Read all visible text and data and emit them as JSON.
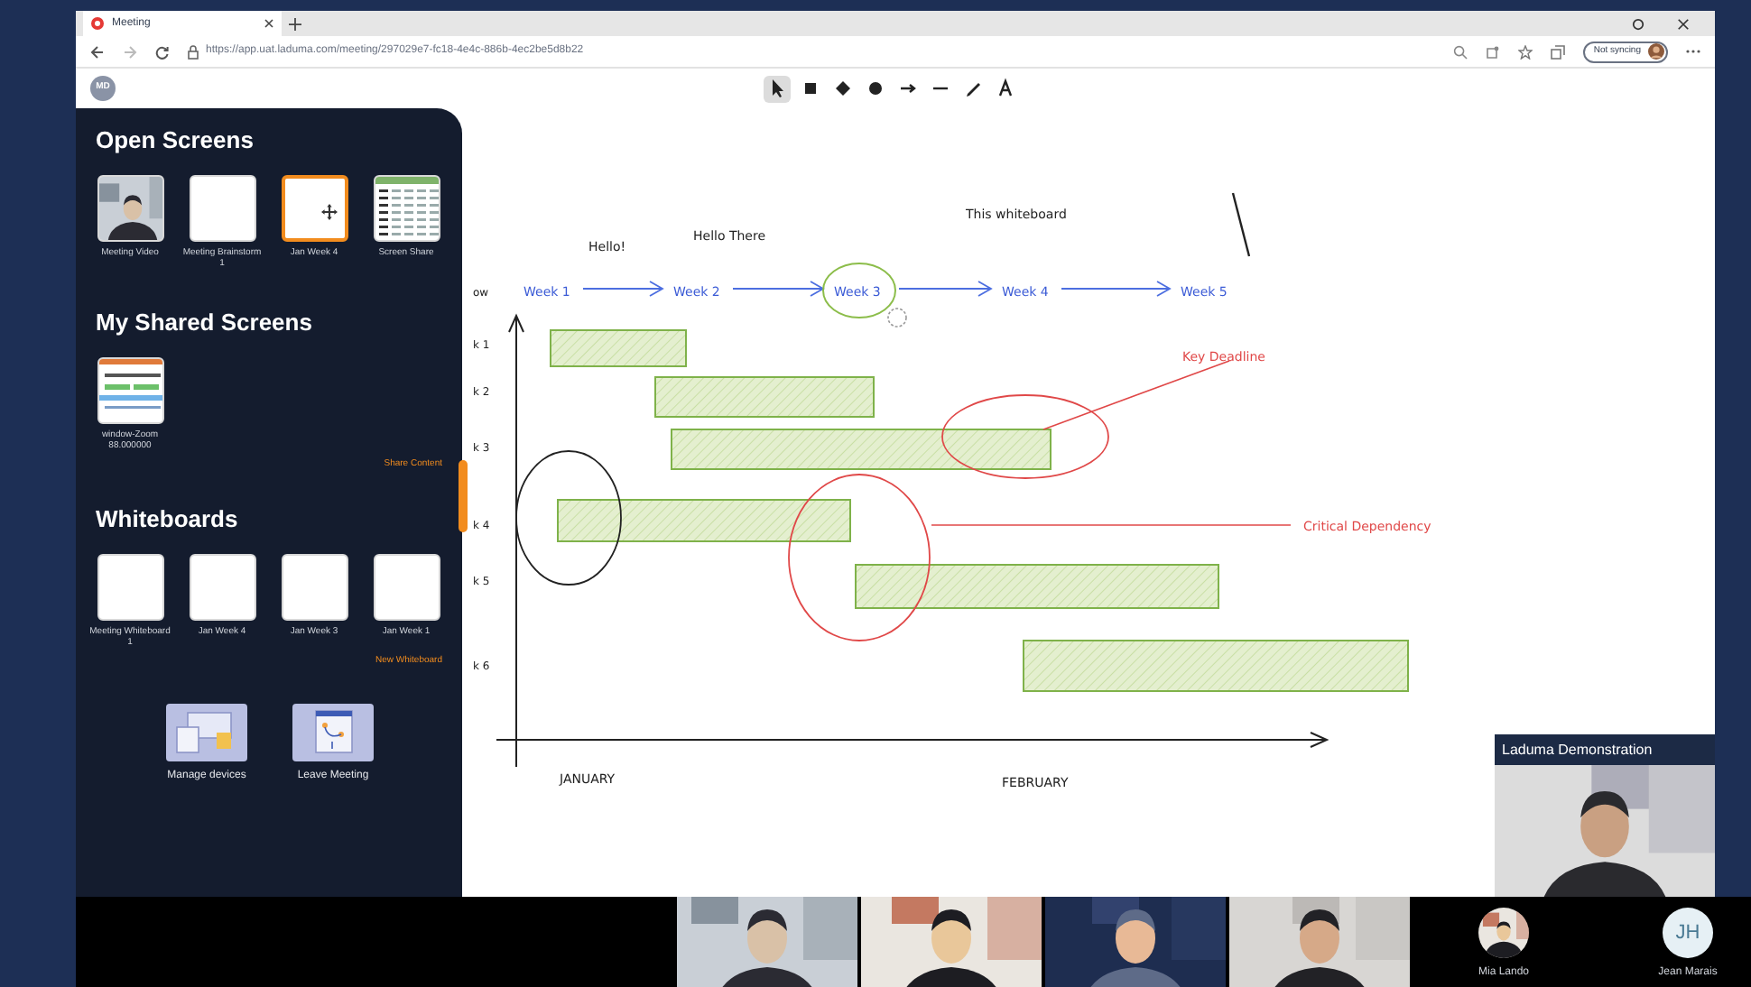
{
  "browser": {
    "tab_title": "Meeting",
    "url": "https://app.uat.laduma.com/meeting/297029e7-fc18-4e4c-886b-4ec2be5d8b22",
    "profile_label": "Not syncing",
    "user_initials": "MD"
  },
  "tools": [
    {
      "kind": "select",
      "selected": true
    },
    {
      "kind": "rectangle",
      "selected": false
    },
    {
      "kind": "diamond",
      "selected": false
    },
    {
      "kind": "ellipse",
      "selected": false
    },
    {
      "kind": "arrow",
      "selected": false
    },
    {
      "kind": "line",
      "selected": false
    },
    {
      "kind": "pencil",
      "selected": false
    },
    {
      "kind": "text",
      "selected": false
    }
  ],
  "sidebar": {
    "open_screens": {
      "title": "Open Screens",
      "items": [
        {
          "label": "Meeting Video",
          "kind": "video",
          "selected": false
        },
        {
          "label": "Meeting Brainstorm 1",
          "kind": "blank",
          "selected": false
        },
        {
          "label": "Jan Week 4",
          "kind": "blank",
          "selected": true
        },
        {
          "label": "Screen Share",
          "kind": "spreadsheet",
          "selected": false
        }
      ]
    },
    "shared_screens": {
      "title": "My Shared Screens",
      "items": [
        {
          "label": "window-Zoom 88.000000",
          "kind": "app"
        }
      ],
      "link": "Share Content"
    },
    "whiteboards": {
      "title": "Whiteboards",
      "items": [
        {
          "label": "Meeting Whiteboard 1",
          "kind": "blank"
        },
        {
          "label": "Jan Week 4",
          "kind": "blank"
        },
        {
          "label": "Jan Week 3",
          "kind": "blank"
        },
        {
          "label": "Jan Week 1",
          "kind": "blank"
        }
      ],
      "link": "New Whiteboard"
    },
    "actions": [
      {
        "label": "Manage devices",
        "kind": "devices"
      },
      {
        "label": "Leave Meeting",
        "kind": "leave"
      }
    ]
  },
  "whiteboard": {
    "notes": [
      "Hello!",
      "Hello There",
      "This whiteboard"
    ],
    "weeks": [
      {
        "label": "Week 1",
        "circled": false
      },
      {
        "label": "Week 2",
        "circled": false
      },
      {
        "label": "Week 3",
        "circled": true
      },
      {
        "label": "Week 4",
        "circled": false
      },
      {
        "label": "Week 5",
        "circled": false
      }
    ],
    "row_labels": [
      "ow",
      "k 1",
      "k 2",
      "k 3",
      "k 4",
      "k 5",
      "k 6"
    ],
    "callouts": [
      "Key Deadline",
      "Critical Dependency"
    ],
    "months": [
      "JANUARY",
      "FEBRUARY"
    ]
  },
  "presenter": {
    "title": "Laduma Demonstration"
  },
  "participants": [
    {
      "kind": "video"
    },
    {
      "kind": "video"
    },
    {
      "kind": "video"
    },
    {
      "kind": "video"
    },
    {
      "kind": "photo_avatar",
      "name": "Mia Lando"
    },
    {
      "kind": "initials",
      "initials": "JH",
      "name": "Jean Marais"
    }
  ]
}
